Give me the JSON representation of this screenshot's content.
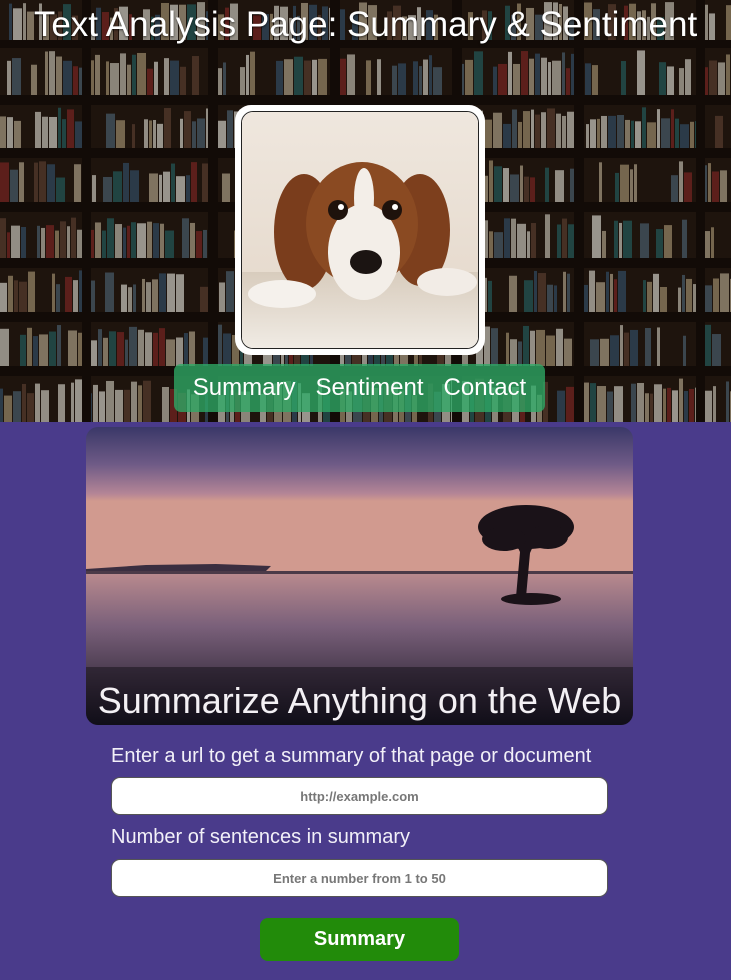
{
  "header": {
    "title": "Text Analysis Page: Summary & Sentiment",
    "nav": [
      "Summary",
      "Sentiment",
      "Contact"
    ]
  },
  "hero": {
    "heading": "Summarize Anything on the Web"
  },
  "form": {
    "url_label": "Enter a url to get a summary of that page or document",
    "url_placeholder": "http://example.com",
    "count_label": "Number of sentences in summary",
    "count_placeholder": "Enter a number from 1 to 50",
    "submit_label": "Summary"
  },
  "colors": {
    "page_background": "#4a3b8b",
    "nav_background": "#2eaa66",
    "submit_button": "#228b0a"
  }
}
